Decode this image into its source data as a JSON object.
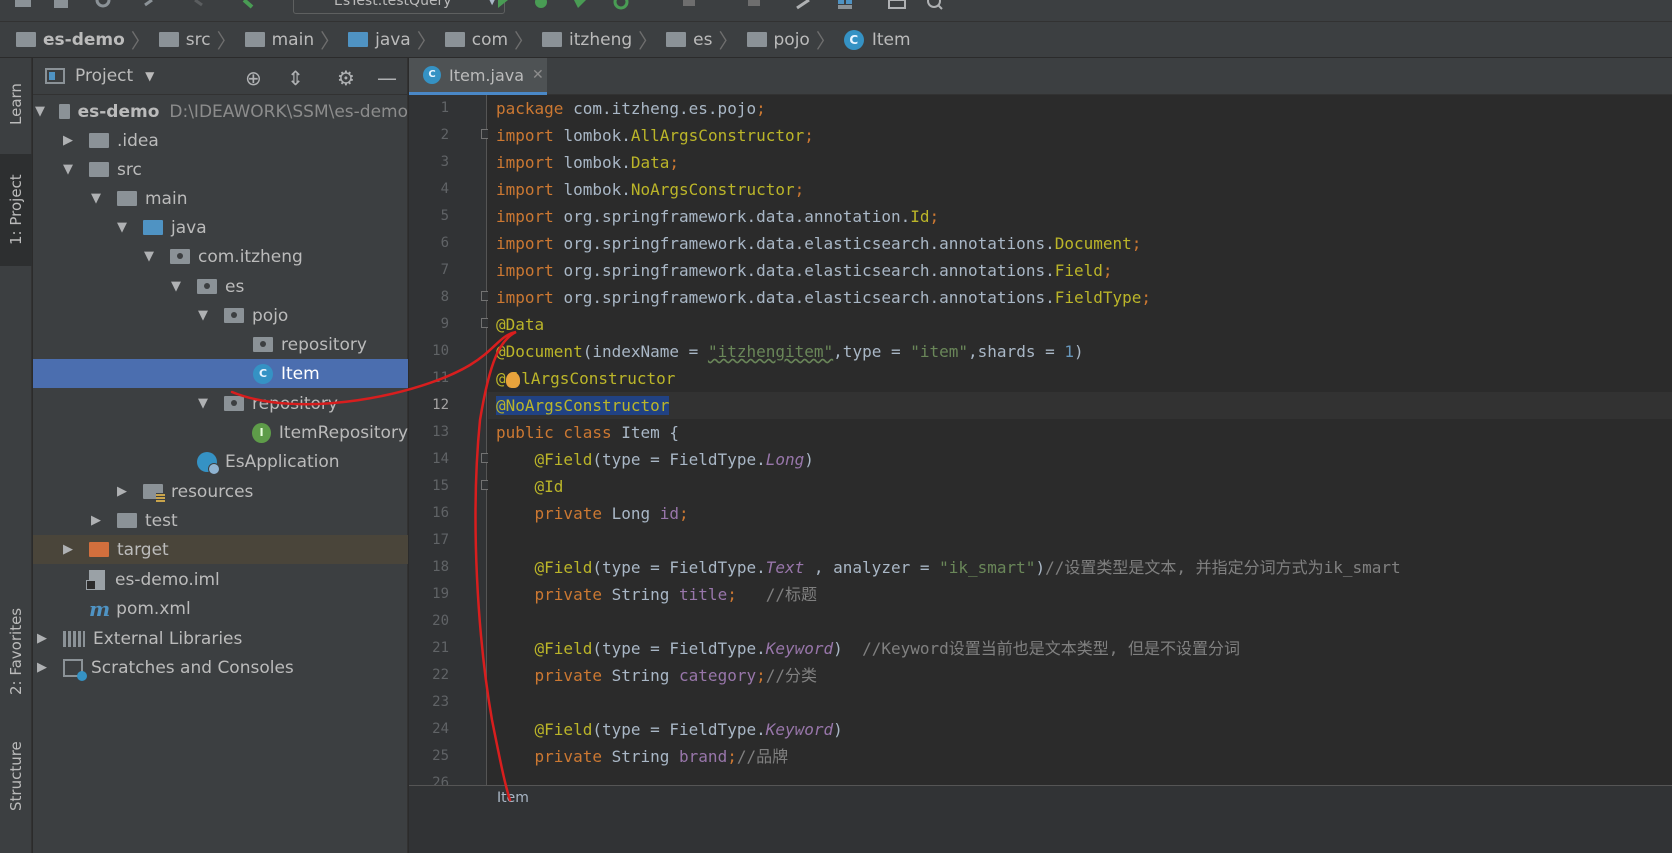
{
  "toolbar": {
    "run_config": "EsTest.testQuery"
  },
  "breadcrumb": [
    {
      "label": "es-demo",
      "icon": "module-icon"
    },
    {
      "label": "src",
      "icon": "folder-icon"
    },
    {
      "label": "main",
      "icon": "folder-icon"
    },
    {
      "label": "java",
      "icon": "source-folder-icon"
    },
    {
      "label": "com",
      "icon": "package-icon"
    },
    {
      "label": "itzheng",
      "icon": "package-icon"
    },
    {
      "label": "es",
      "icon": "package-icon"
    },
    {
      "label": "pojo",
      "icon": "package-icon"
    },
    {
      "label": "Item",
      "icon": "class-icon"
    }
  ],
  "side_tabs": {
    "learn": "Learn",
    "project": "1: Project",
    "favorites": "2: Favorites",
    "structure": "Structure"
  },
  "project_panel": {
    "title": "Project",
    "tree": [
      {
        "label": "es-demo",
        "path": "D:\\IDEAWORK\\SSM\\es-demo"
      },
      {
        "label": ".idea"
      },
      {
        "label": "src"
      },
      {
        "label": "main"
      },
      {
        "label": "java"
      },
      {
        "label": "com.itzheng"
      },
      {
        "label": "es"
      },
      {
        "label": "pojo"
      },
      {
        "label": "repository"
      },
      {
        "label": "Item"
      },
      {
        "label": "repository"
      },
      {
        "label": "ItemRepository"
      },
      {
        "label": "EsApplication"
      },
      {
        "label": "resources"
      },
      {
        "label": "test"
      },
      {
        "label": "target"
      },
      {
        "label": "es-demo.iml"
      },
      {
        "label": "pom.xml"
      },
      {
        "label": "External Libraries"
      },
      {
        "label": "Scratches and Consoles"
      }
    ]
  },
  "editor": {
    "tab": "Item.java",
    "class_icon_letter": "C",
    "interface_icon_letter": "I",
    "line_numbers": [
      "1",
      "2",
      "3",
      "4",
      "5",
      "6",
      "7",
      "8",
      "9",
      "10",
      "11",
      "12",
      "13",
      "14",
      "15",
      "16",
      "17",
      "18",
      "19",
      "20",
      "21",
      "22",
      "23",
      "24",
      "25",
      "26"
    ],
    "status_crumb": "Item",
    "code": {
      "l1_pkg": "com.itzheng.es.pojo",
      "l2": "lombok.",
      "l2b": "AllArgsConstructor",
      "l3": "lombok.",
      "l3b": "Data",
      "l4": "lombok.",
      "l4b": "NoArgsConstructor",
      "l5": "org.springframework.data.annotation.",
      "l5b": "Id",
      "l6": "org.springframework.data.elasticsearch.annotations.",
      "l6b": "Document",
      "l7": "org.springframework.data.elasticsearch.annotations.",
      "l7b": "Field",
      "l8": "org.springframework.data.elasticsearch.annotations.",
      "l8b": "FieldType",
      "l9": "@Data",
      "l10_ann": "@Document",
      "l10_k1": "indexName = ",
      "l10_s1": "\"itzhengitem\"",
      "l10_k2": ",type = ",
      "l10_s2": "\"item\"",
      "l10_k3": ",shards = ",
      "l10_n": "1",
      "l11_a": "@",
      "l11_b": "llArgsConstructor",
      "l12": "@NoArgsConstructor",
      "l13_cls": "Item {",
      "l14_ann": "@Field",
      "l14_a": "(type = FieldType.",
      "l14_b": "Long",
      "l14_c": ")",
      "l15": "@Id",
      "l16_t": "Long ",
      "l16_f": "id",
      "l18_ann": "@Field",
      "l18_a": "(type = FieldType.",
      "l18_b": "Text",
      "l18_c": " , analyzer = ",
      "l18_s": "\"ik_smart\"",
      "l18_d": ")",
      "l18_cm": "//设置类型是文本, 并指定分词方式为ik_smart",
      "l19_t": "String ",
      "l19_f": "title",
      "l19_cm": "//标题",
      "l21_ann": "@Field",
      "l21_a": "(type = FieldType.",
      "l21_b": "Keyword",
      "l21_c": ")",
      "l21_cm": "//Keyword设置当前也是文本类型, 但是不设置分词",
      "l22_t": "String ",
      "l22_f": "category",
      "l22_cm": "//分类",
      "l24_ann": "@Field",
      "l24_a": "(type = FieldType.",
      "l24_b": "Keyword",
      "l24_c": ")",
      "l25_t": "String ",
      "l25_f": "brand",
      "l25_cm": "//品牌"
    }
  },
  "colors": {
    "keyword": "#cc7832",
    "annotation": "#bbb529",
    "string": "#6a8759",
    "number": "#6897bb",
    "field": "#9876aa",
    "selection": "#4b6eaf",
    "annotation_stroke": "#d81e1e"
  }
}
